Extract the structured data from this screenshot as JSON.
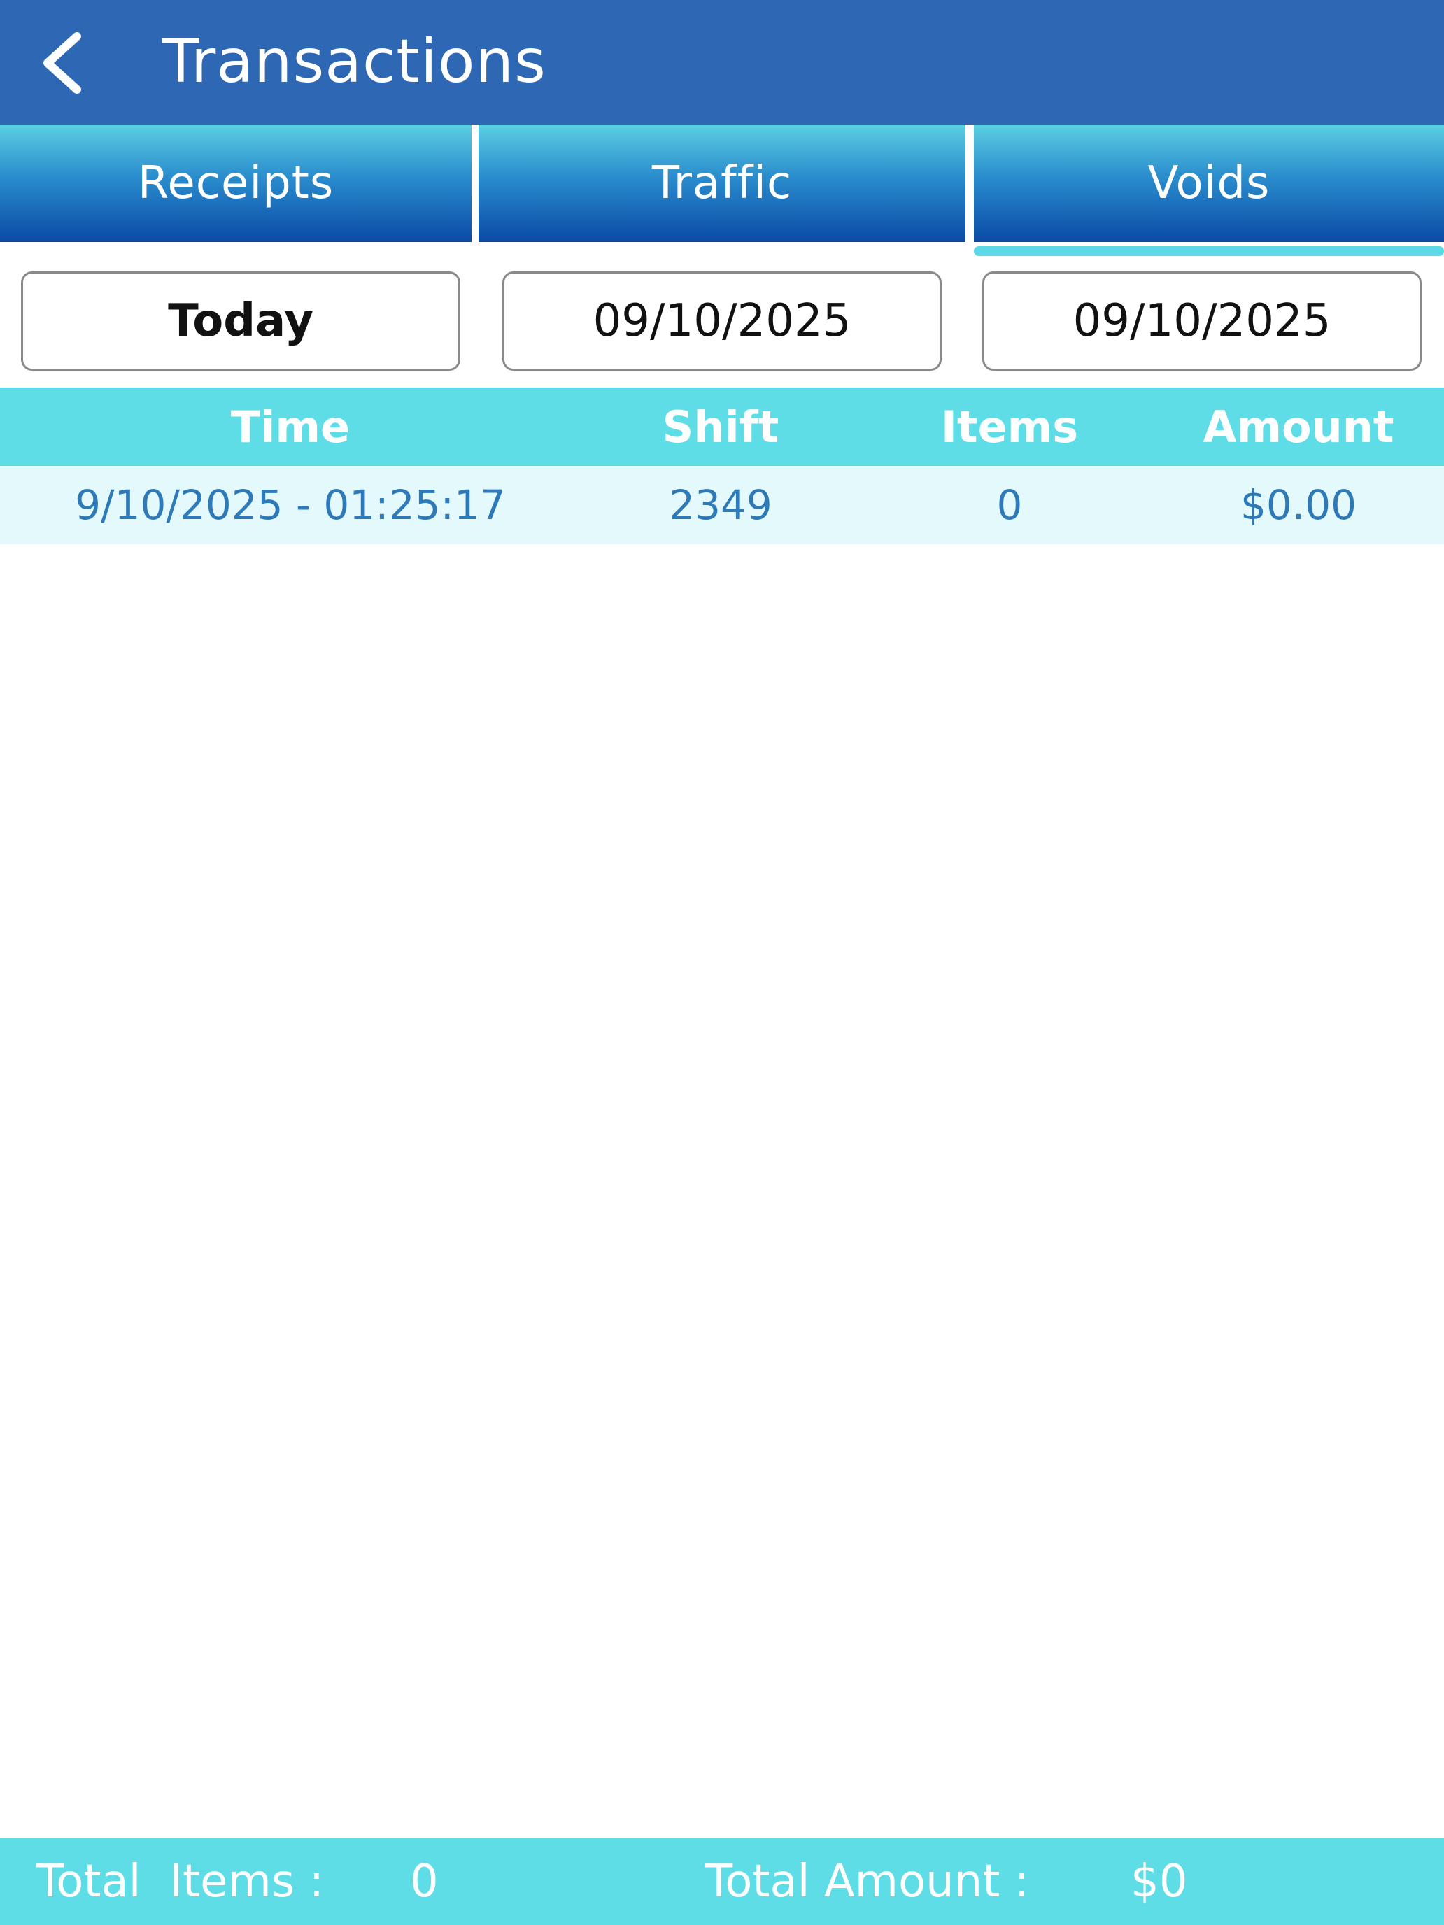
{
  "header": {
    "title": "Transactions",
    "back_icon": "chevron-left-icon"
  },
  "tabs": [
    {
      "label": "Receipts",
      "active": false
    },
    {
      "label": "Traffic",
      "active": false
    },
    {
      "label": "Voids",
      "active": true
    }
  ],
  "filters": {
    "preset": "Today",
    "start_date": "09/10/2025",
    "end_date": "09/10/2025"
  },
  "table": {
    "columns": [
      "Time",
      "Shift",
      "Items",
      "Amount"
    ],
    "rows": [
      {
        "time": "9/10/2025 - 01:25:17",
        "shift": "2349",
        "items": "0",
        "amount": "$0.00"
      }
    ]
  },
  "footer": {
    "total_items_label": "Total  Items :",
    "total_items_value": "0",
    "total_amount_label": "Total Amount :",
    "total_amount_value": "$0"
  },
  "colors": {
    "header_bg": "#2e68b4",
    "accent": "#5edde6",
    "row_bg": "#e3f9fb",
    "row_text": "#2e79b8"
  }
}
